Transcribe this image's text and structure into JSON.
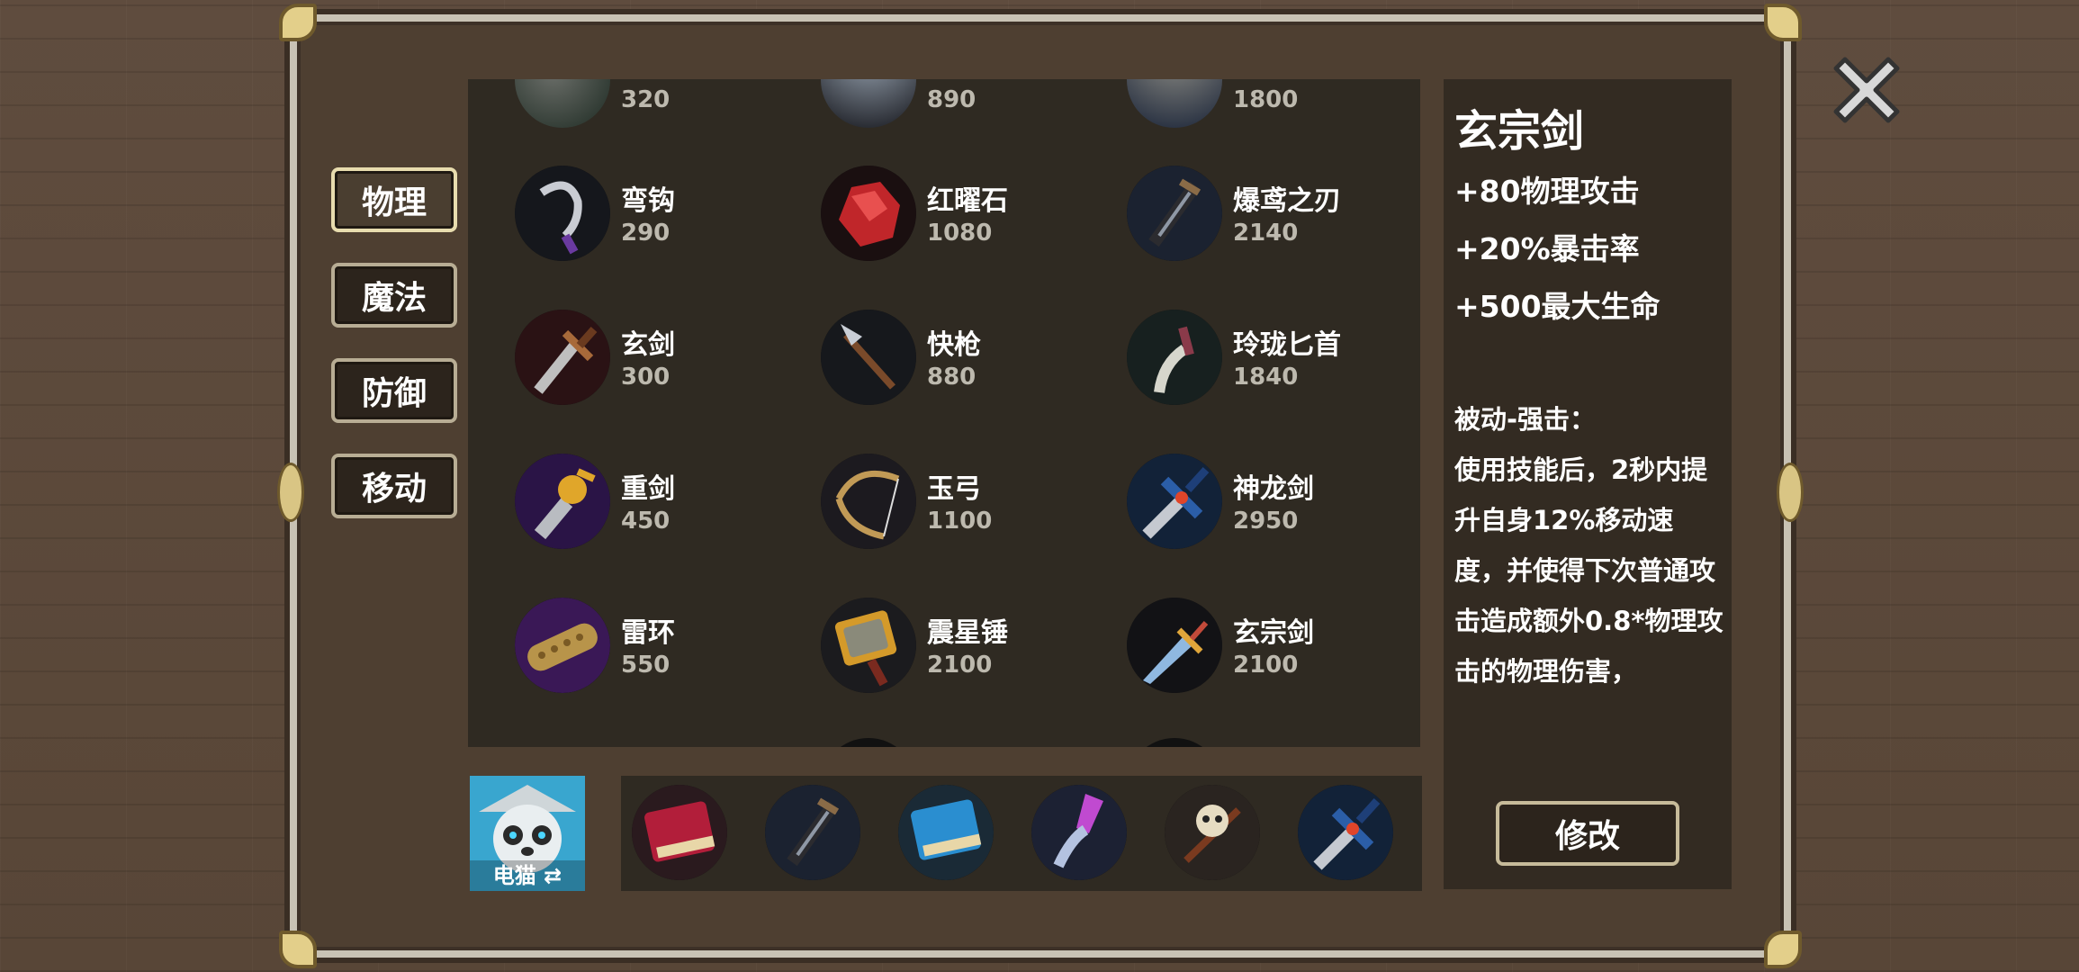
{
  "tabs": [
    {
      "label": "物理",
      "active": true
    },
    {
      "label": "魔法",
      "active": false
    },
    {
      "label": "防御",
      "active": false
    },
    {
      "label": "移动",
      "active": false
    }
  ],
  "items_partial_top": [
    {
      "price": "320"
    },
    {
      "price": "890"
    },
    {
      "price": "1800"
    }
  ],
  "items": [
    {
      "name": "弯钩",
      "price": "290",
      "icon": "hook-icon"
    },
    {
      "name": "红曜石",
      "price": "1080",
      "icon": "red-stone-icon"
    },
    {
      "name": "爆鸢之刃",
      "price": "2140",
      "icon": "dark-blade-icon"
    },
    {
      "name": "玄剑",
      "price": "300",
      "icon": "sword-icon"
    },
    {
      "name": "快枪",
      "price": "880",
      "icon": "spear-icon"
    },
    {
      "name": "玲珑匕首",
      "price": "1840",
      "icon": "curved-dagger-icon"
    },
    {
      "name": "重剑",
      "price": "450",
      "icon": "heavy-sword-icon"
    },
    {
      "name": "玉弓",
      "price": "1100",
      "icon": "bow-icon"
    },
    {
      "name": "神龙剑",
      "price": "2950",
      "icon": "dragon-sword-icon"
    },
    {
      "name": "雷环",
      "price": "550",
      "icon": "thunder-ring-icon"
    },
    {
      "name": "震星锤",
      "price": "2100",
      "icon": "hammer-icon"
    },
    {
      "name": "玄宗剑",
      "price": "2100",
      "icon": "blue-dagger-icon"
    }
  ],
  "detail": {
    "title": "玄宗剑",
    "stats": [
      "+80物理攻击",
      "+20%暴击率",
      "+500最大生命"
    ],
    "passive_title": "被动-强击：",
    "passive_text": "使用技能后，2秒内提升自身12%移动速度，并使得下次普通攻击造成额外0.8*物理攻击的物理伤害，"
  },
  "edit_button": "修改",
  "hero": {
    "name": "电猫 ⇄"
  },
  "equipped": [
    "red-book-icon",
    "dark-blade-icon",
    "blue-book-icon",
    "crystal-claw-icon",
    "skull-staff-icon",
    "dragon-sword-icon"
  ],
  "colors": {
    "panel": "#2f2a22",
    "frame": "#c8c2b4",
    "text": "#ffffff",
    "price": "#bdb9ae"
  }
}
